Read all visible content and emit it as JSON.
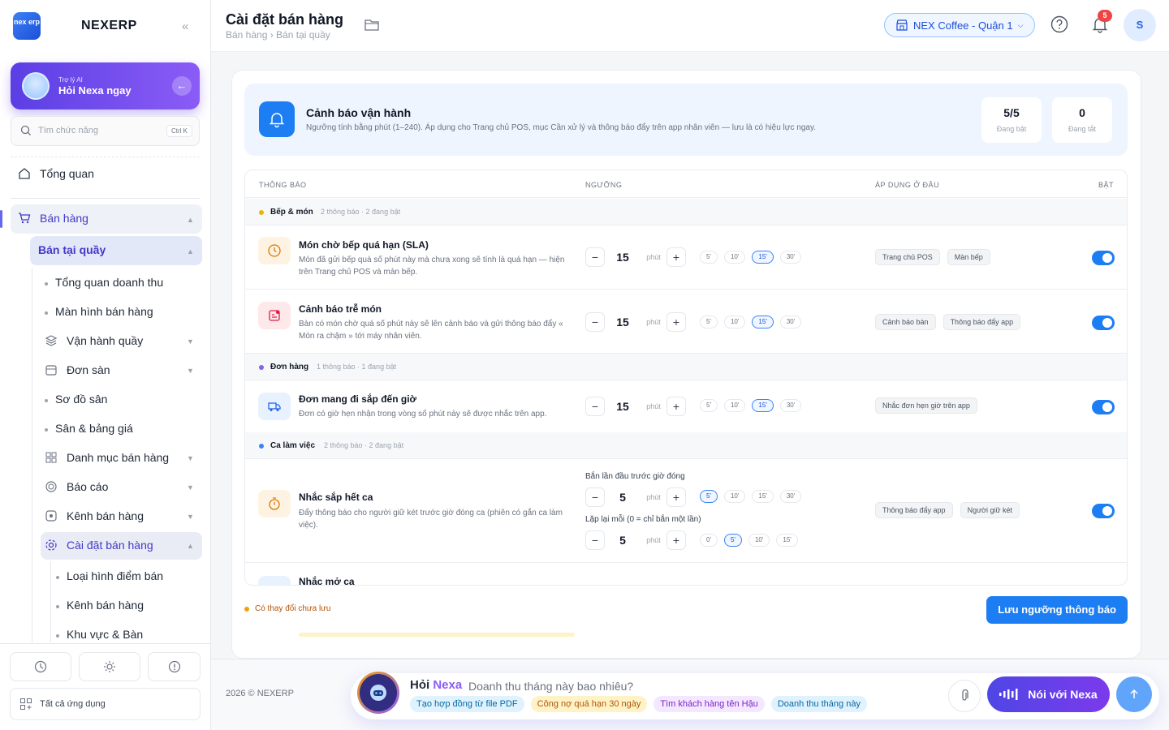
{
  "brand": {
    "logo_text": "nex erp",
    "name": "NEXERP"
  },
  "ai_card": {
    "small": "Trợ lý AI",
    "big": "Hỏi Nexa ngay"
  },
  "search": {
    "placeholder": "Tìm chức năng",
    "shortcut": "Ctrl K"
  },
  "nav": {
    "overview": "Tổng quan",
    "sales": "Bán hàng",
    "counter": "Bán tại quầy",
    "revenue": "Tổng quan doanh thu",
    "pos_screen": "Màn hình bán hàng",
    "ops": "Vận hành quầy",
    "floor_orders": "Đơn sàn",
    "floor_map": "Sơ đồ sân",
    "pricing": "Sân & bảng giá",
    "catalog": "Danh mục bán hàng",
    "reports": "Báo cáo",
    "channels": "Kênh bán hàng",
    "settings": "Cài đặt bán hàng",
    "pos_types": "Loại hình điểm bán",
    "sales_channels": "Kênh bán hàng",
    "areas": "Khu vực & Bàn"
  },
  "all_apps": "Tất cả ứng dụng",
  "header": {
    "title": "Cài đặt bán hàng",
    "breadcrumb": "Bán hàng › Bán tại quầy",
    "store": "NEX Coffee - Quận 1",
    "notif_count": "5",
    "avatar": "S"
  },
  "banner": {
    "title": "Cảnh báo vận hành",
    "desc": "Ngưỡng tính bằng phút (1–240). Áp dụng cho Trang chủ POS, mục Cần xử lý và thông báo đẩy trên app nhân viên — lưu là có hiệu lực ngay.",
    "stat_on_value": "5/5",
    "stat_on_label": "Đang bật",
    "stat_off_value": "0",
    "stat_off_label": "Đang tắt"
  },
  "columns": {
    "notice": "THÔNG BÁO",
    "threshold": "NGƯỠNG",
    "applies": "ÁP DỤNG Ở ĐÂU",
    "enabled": "BẬT"
  },
  "groups": [
    {
      "name": "Bếp & món",
      "count": "2 thông báo · 2 đang bật",
      "color": "#eab308"
    },
    {
      "name": "Đơn hàng",
      "count": "1 thông báo · 1 đang bật",
      "color": "#8b5cf6"
    },
    {
      "name": "Ca làm việc",
      "count": "2 thông báo · 2 đang bật",
      "color": "#3b82f6"
    }
  ],
  "unit": "phút",
  "rows": [
    {
      "title": "Món chờ bếp quá hạn (SLA)",
      "desc": "Món đã gửi bếp quá số phút này mà chưa xong sẽ tính là quá hạn — hiện trên Trang chủ POS và màn bếp.",
      "value": "15",
      "presets": [
        "5'",
        "10'",
        "15'",
        "30'"
      ],
      "apps": [
        "Trang chủ POS",
        "Màn bếp"
      ],
      "enabled": true
    },
    {
      "title": "Cảnh báo trễ món",
      "desc": "Bàn có món chờ quá số phút này sẽ lên cảnh báo và gửi thông báo đẩy « Món ra chậm » tới máy nhân viên.",
      "value": "15",
      "presets": [
        "5'",
        "10'",
        "15'",
        "30'"
      ],
      "apps": [
        "Cảnh báo bàn",
        "Thông báo đẩy app"
      ],
      "enabled": true
    },
    {
      "title": "Đơn mang đi sắp đến giờ",
      "desc": "Đơn có giờ hẹn nhận trong vòng số phút này sẽ được nhắc trên app.",
      "value": "15",
      "presets": [
        "5'",
        "10'",
        "15'",
        "30'"
      ],
      "apps": [
        "Nhắc đơn hẹn giờ trên app"
      ],
      "enabled": true
    },
    {
      "title": "Nhắc sắp hết ca",
      "desc": "Đẩy thông báo cho người giữ két trước giờ đóng ca (phiên có gắn ca làm việc).",
      "first_label": "Bắn lần đầu trước giờ đóng",
      "value": "5",
      "presets": [
        "5'",
        "10'",
        "15'",
        "30'"
      ],
      "repeat_label": "Lặp lại mỗi (0 = chỉ bắn một lần)",
      "repeat_value": "5",
      "repeat_presets": [
        "0'",
        "5'",
        "10'",
        "15'"
      ],
      "apps": [
        "Thông báo đẩy app",
        "Người giữ két"
      ],
      "enabled": true
    },
    {
      "title": "Nhắc mở ca"
    }
  ],
  "save": {
    "unsaved": "Có thay đổi chưa lưu",
    "button": "Lưu ngưỡng thông báo"
  },
  "footer": {
    "copyright": "2026 © NEXERP"
  },
  "ask": {
    "title_a": "Hỏi",
    "title_b": "Nexa",
    "question": "Doanh thu tháng này bao nhiêu?",
    "suggestions": [
      "Tạo hợp đồng từ file PDF",
      "Công nợ quá hạn 30 ngày",
      "Tìm khách hàng tên Hậu",
      "Doanh thu tháng này"
    ],
    "voice": "Nói với Nexa"
  }
}
